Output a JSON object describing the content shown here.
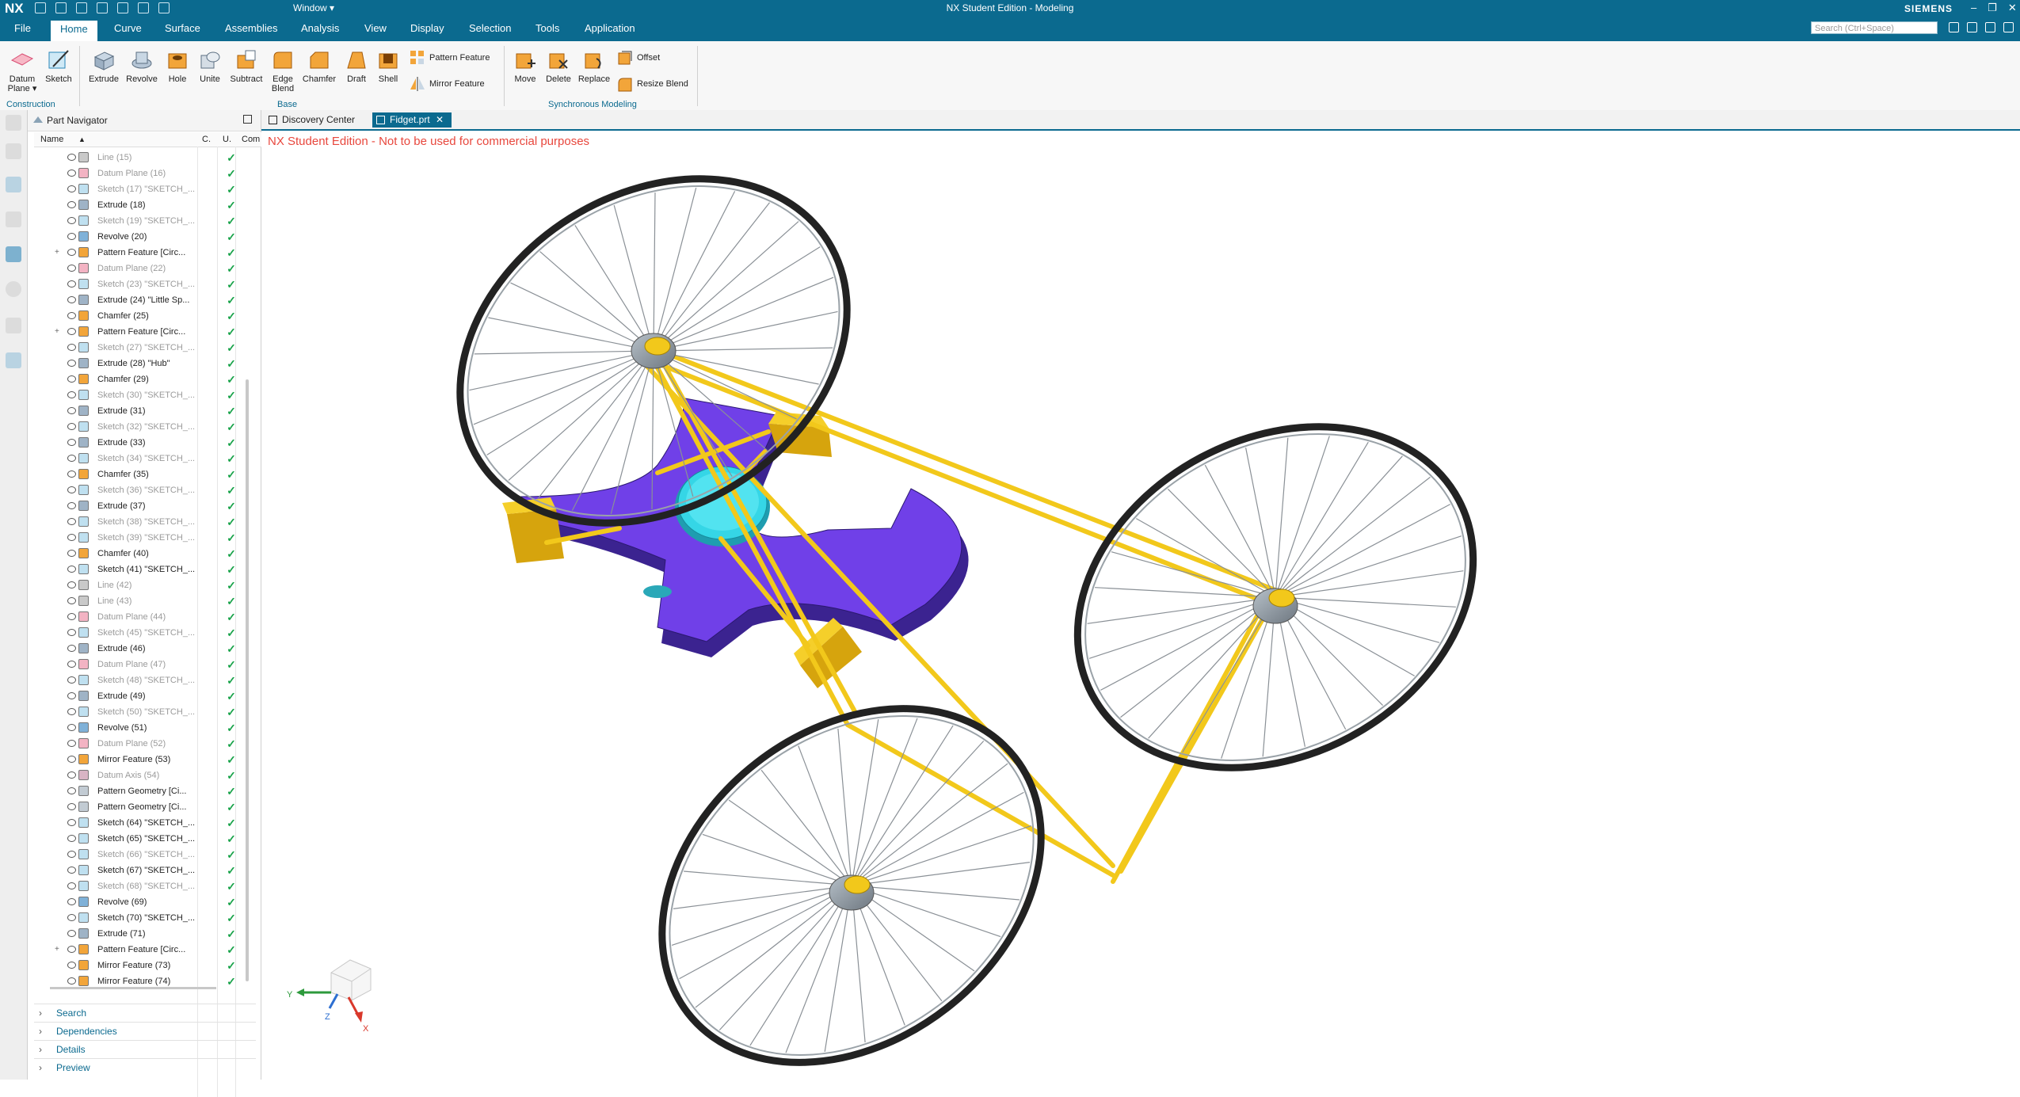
{
  "app": {
    "logo": "NX",
    "window_menu": "Window ▾",
    "title": "NX Student Edition - Modeling",
    "brand": "SIEMENS"
  },
  "menu": {
    "items": [
      "File",
      "Home",
      "Curve",
      "Surface",
      "Assemblies",
      "Analysis",
      "View",
      "Display",
      "Selection",
      "Tools",
      "Application"
    ],
    "active": "Home",
    "search_placeholder": "Search (Ctrl+Space)"
  },
  "ribbon": {
    "construction": {
      "datum_plane": "Datum Plane ▾",
      "sketch": "Sketch",
      "group": "Construction"
    },
    "base": {
      "extrude": "Extrude",
      "revolve": "Revolve",
      "hole": "Hole",
      "unite": "Unite",
      "subtract": "Subtract",
      "edge_blend": "Edge Blend",
      "chamfer": "Chamfer",
      "draft": "Draft",
      "shell": "Shell",
      "pattern_feature": "Pattern Feature",
      "mirror_feature": "Mirror Feature",
      "group": "Base"
    },
    "sync": {
      "move": "Move",
      "delete": "Delete",
      "replace": "Replace",
      "offset": "Offset",
      "resize_blend": "Resize Blend",
      "group": "Synchronous Modeling"
    }
  },
  "navigator": {
    "title": "Part Navigator",
    "columns": {
      "name": "Name",
      "c": "C.",
      "u": "U.",
      "comment": "Com"
    },
    "rows": [
      {
        "label": "Line (15)",
        "type": "line",
        "gray": true
      },
      {
        "label": "Datum Plane (16)",
        "type": "datum",
        "gray": true
      },
      {
        "label": "Sketch (17) \"SKETCH_...",
        "type": "sketch",
        "gray": true
      },
      {
        "label": "Extrude (18)",
        "type": "extrude",
        "gray": false
      },
      {
        "label": "Sketch (19) \"SKETCH_...",
        "type": "sketch",
        "gray": true
      },
      {
        "label": "Revolve (20)",
        "type": "revolve",
        "gray": false
      },
      {
        "label": "Pattern Feature [Circ...",
        "type": "pattern",
        "gray": false,
        "expand": true
      },
      {
        "label": "Datum Plane (22)",
        "type": "datum",
        "gray": true
      },
      {
        "label": "Sketch (23) \"SKETCH_...",
        "type": "sketch",
        "gray": true
      },
      {
        "label": "Extrude (24) \"Little Sp...",
        "type": "extrude",
        "gray": false
      },
      {
        "label": "Chamfer (25)",
        "type": "chamfer",
        "gray": false
      },
      {
        "label": "Pattern Feature [Circ...",
        "type": "pattern",
        "gray": false,
        "expand": true
      },
      {
        "label": "Sketch (27) \"SKETCH_...",
        "type": "sketch",
        "gray": true
      },
      {
        "label": "Extrude (28) \"Hub\"",
        "type": "extrude",
        "gray": false
      },
      {
        "label": "Chamfer (29)",
        "type": "chamfer",
        "gray": false
      },
      {
        "label": "Sketch (30) \"SKETCH_...",
        "type": "sketch",
        "gray": true
      },
      {
        "label": "Extrude (31)",
        "type": "extrude",
        "gray": false
      },
      {
        "label": "Sketch (32) \"SKETCH_...",
        "type": "sketch",
        "gray": true
      },
      {
        "label": "Extrude (33)",
        "type": "extrude",
        "gray": false
      },
      {
        "label": "Sketch (34) \"SKETCH_...",
        "type": "sketch",
        "gray": true
      },
      {
        "label": "Chamfer (35)",
        "type": "chamfer",
        "gray": false
      },
      {
        "label": "Sketch (36) \"SKETCH_...",
        "type": "sketch",
        "gray": true
      },
      {
        "label": "Extrude (37)",
        "type": "extrude",
        "gray": false
      },
      {
        "label": "Sketch (38) \"SKETCH_...",
        "type": "sketch",
        "gray": true
      },
      {
        "label": "Sketch (39) \"SKETCH_...",
        "type": "sketch",
        "gray": true
      },
      {
        "label": "Chamfer (40)",
        "type": "chamfer",
        "gray": false
      },
      {
        "label": "Sketch (41) \"SKETCH_...",
        "type": "sketch",
        "gray": false
      },
      {
        "label": "Line (42)",
        "type": "line",
        "gray": true
      },
      {
        "label": "Line (43)",
        "type": "line",
        "gray": true
      },
      {
        "label": "Datum Plane (44)",
        "type": "datum",
        "gray": true
      },
      {
        "label": "Sketch (45) \"SKETCH_...",
        "type": "sketch",
        "gray": true
      },
      {
        "label": "Extrude (46)",
        "type": "extrude",
        "gray": false
      },
      {
        "label": "Datum Plane (47)",
        "type": "datum",
        "gray": true
      },
      {
        "label": "Sketch (48) \"SKETCH_...",
        "type": "sketch",
        "gray": true
      },
      {
        "label": "Extrude (49)",
        "type": "extrude",
        "gray": false
      },
      {
        "label": "Sketch (50) \"SKETCH_...",
        "type": "sketch",
        "gray": true
      },
      {
        "label": "Revolve (51)",
        "type": "revolve",
        "gray": false
      },
      {
        "label": "Datum Plane (52)",
        "type": "datum",
        "gray": true
      },
      {
        "label": "Mirror Feature (53)",
        "type": "mirror",
        "gray": false
      },
      {
        "label": "Datum Axis (54)",
        "type": "axis",
        "gray": true
      },
      {
        "label": "Pattern Geometry [Ci...",
        "type": "pgeom",
        "gray": false
      },
      {
        "label": "Pattern Geometry [Ci...",
        "type": "pgeom",
        "gray": false
      },
      {
        "label": "Sketch (64) \"SKETCH_...",
        "type": "sketch",
        "gray": false
      },
      {
        "label": "Sketch (65) \"SKETCH_...",
        "type": "sketch",
        "gray": false
      },
      {
        "label": "Sketch (66) \"SKETCH_...",
        "type": "sketch",
        "gray": true
      },
      {
        "label": "Sketch (67) \"SKETCH_...",
        "type": "sketch",
        "gray": false
      },
      {
        "label": "Sketch (68) \"SKETCH_...",
        "type": "sketch",
        "gray": true
      },
      {
        "label": "Revolve (69)",
        "type": "revolve",
        "gray": false
      },
      {
        "label": "Sketch (70) \"SKETCH_...",
        "type": "sketch",
        "gray": false
      },
      {
        "label": "Extrude (71)",
        "type": "extrude",
        "gray": false
      },
      {
        "label": "Pattern Feature [Circ...",
        "type": "pattern",
        "gray": false,
        "expand": true
      },
      {
        "label": "Mirror Feature (73)",
        "type": "mirror",
        "gray": false
      },
      {
        "label": "Mirror Feature (74)",
        "type": "mirror",
        "gray": false
      }
    ],
    "accordion": [
      "Search",
      "Dependencies",
      "Details",
      "Preview"
    ]
  },
  "tabs": [
    {
      "label": "Discovery Center",
      "active": false
    },
    {
      "label": "Fidget.prt",
      "active": true,
      "close": "✕"
    }
  ],
  "viewport": {
    "watermark": "NX Student Edition - Not to be used for commercial purposes",
    "triad": {
      "x": "X",
      "y": "Y",
      "z": "Z"
    }
  },
  "colors": {
    "header": "#0b6a8f",
    "watermark": "#e8473d",
    "body": "#6a33c9",
    "frame": "#f2c81b",
    "cap": "#35d6e6",
    "check": "#19a34a"
  }
}
